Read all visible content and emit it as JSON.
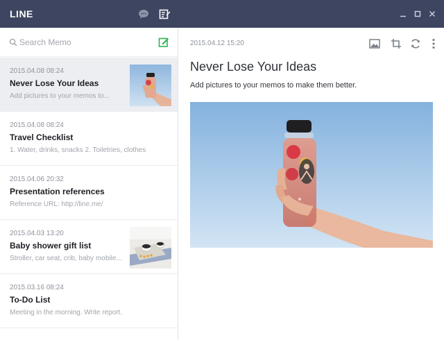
{
  "app": {
    "brand": "LINE",
    "title_bar": {
      "chat_icon": "chat-bubble-icon",
      "memo_icon": "memo-icon",
      "window_controls": [
        "minimize-icon",
        "maximize-icon",
        "close-icon"
      ]
    }
  },
  "search": {
    "placeholder": "Search Memo",
    "value": ""
  },
  "colors": {
    "title_bar": "#3d4560",
    "new_memo_accent": "#2cb24f",
    "selected_row": "#eceef2"
  },
  "memos": [
    {
      "date": "2015.04.08  08:24",
      "title": "Never Lose Your Ideas",
      "snippet": "Add pictures to your memos to...",
      "thumbnail": "bottle-photo",
      "selected": true
    },
    {
      "date": "2015.04.08  08:24",
      "title": "Travel Checklist",
      "snippet": "1. Water, drinks, snacks   2. Toiletries, clothes"
    },
    {
      "date": "2015.04.06  20:32",
      "title": "Presentation references",
      "snippet": "Reference URL: http://line.me/"
    },
    {
      "date": "2015.04.03  13:20",
      "title": "Baby shower gift list",
      "snippet": "Stroller, car seat, crib, baby mobile...",
      "thumbnail": "table-photo"
    },
    {
      "date": "2015.03.16  08:24",
      "title": "To-Do List",
      "snippet": "Meeting in the morning. Write report."
    }
  ],
  "detail": {
    "date": "2015.04.12  15:20",
    "title": "Never Lose Your Ideas",
    "body": "Add pictures to your memos to make them better.",
    "tools": [
      "image-icon",
      "crop-icon",
      "rotate-icon",
      "more-icon"
    ]
  }
}
